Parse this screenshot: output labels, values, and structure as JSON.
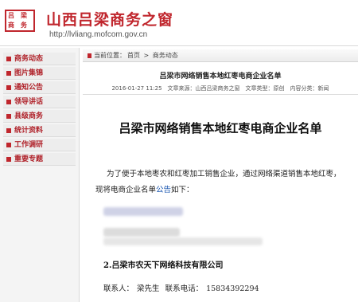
{
  "header": {
    "logo_chars": [
      "吕",
      "梁",
      "商",
      "务"
    ],
    "title": "山西吕梁商务之窗",
    "url": "http://lvliang.mofcom.gov.cn"
  },
  "sidebar": {
    "items": [
      {
        "label": "商务动态"
      },
      {
        "label": "图片集锦"
      },
      {
        "label": "通知公告"
      },
      {
        "label": "领导讲话"
      },
      {
        "label": "县级商务"
      },
      {
        "label": "统计资料"
      },
      {
        "label": "工作调研"
      },
      {
        "label": "重要专题"
      }
    ]
  },
  "breadcrumb": {
    "prefix": "当前位置：",
    "home": "首页",
    "sep": ">",
    "current": "商务动态"
  },
  "article": {
    "head": "吕梁市网络销售本地红枣电商企业名单",
    "meta": "2016-01-27 11:25　文章来源：山西吕梁商务之窗　文章类型：原创　内容分类：新闻",
    "title": "吕梁市网络销售本地红枣电商企业名单",
    "para1": "为了便于本地枣农和红枣加工销售企业，通过网络渠道销售本地红枣，",
    "para2_prefix": "现将电商企业名单",
    "para2_link": "公告",
    "para2_suffix": "如下：",
    "company": "2.吕梁市农天下网络科技有限公司",
    "contact_label": "联系人：",
    "contact_name": "梁先生",
    "phone_label": "联系电话：",
    "phone": "15834392294"
  },
  "colors": {
    "brand_red": "#c0262d",
    "link_blue": "#1a56b0"
  }
}
